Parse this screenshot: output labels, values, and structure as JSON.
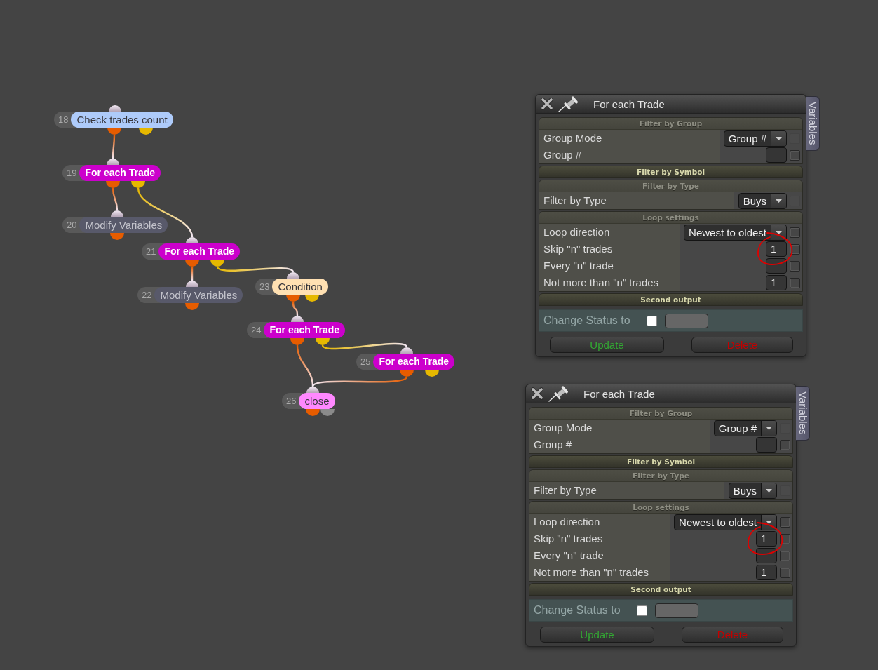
{
  "nodes": [
    {
      "number": "18",
      "label": "Check trades count",
      "kind": "check",
      "color": "#aecbfa",
      "outputs": [
        {
          "color": "#e65c00"
        },
        {
          "color": "#e6b800"
        }
      ]
    },
    {
      "number": "19",
      "label": "For each Trade",
      "kind": "loop",
      "color": "#cc00cc",
      "outputs": [
        {
          "color": "#e65c00"
        },
        {
          "color": "#e6b800"
        }
      ]
    },
    {
      "number": "20",
      "label": "Modify Variables",
      "kind": "action",
      "color": "#58596a",
      "outputs": [
        {
          "color": "#e65c00"
        }
      ]
    },
    {
      "number": "21",
      "label": "For each Trade",
      "kind": "loop",
      "color": "#cc00cc",
      "outputs": [
        {
          "color": "#e65c00"
        },
        {
          "color": "#e6b800"
        }
      ]
    },
    {
      "number": "22",
      "label": "Modify Variables",
      "kind": "action",
      "color": "#58596a",
      "outputs": [
        {
          "color": "#e65c00"
        }
      ]
    },
    {
      "number": "23",
      "label": "Condition",
      "kind": "condition",
      "color": "#ffe0b2",
      "outputs": [
        {
          "color": "#e65c00"
        },
        {
          "color": "#e6b800"
        }
      ]
    },
    {
      "number": "24",
      "label": "For each Trade",
      "kind": "loop",
      "color": "#cc00cc",
      "outputs": [
        {
          "color": "#e65c00"
        },
        {
          "color": "#e6b800"
        }
      ]
    },
    {
      "number": "25",
      "label": "For each Trade",
      "kind": "loop",
      "color": "#cc00cc",
      "outputs": [
        {
          "color": "#e65c00"
        },
        {
          "color": "#e6b800"
        }
      ]
    },
    {
      "number": "26",
      "label": "close",
      "kind": "close",
      "color": "#ff88ff",
      "outputs": [
        {
          "color": "#e65c00"
        },
        {
          "color": "#8a8a8a"
        }
      ]
    }
  ],
  "panels": [
    {
      "title": "For each Trade",
      "side_tab": "Variables",
      "sections": [
        {
          "kind": "group",
          "title": "Filter by Group",
          "rows": [
            {
              "kind": "select",
              "label": "Group Mode",
              "value": "Group #",
              "annotated": false,
              "checkbox": {
                "checked": false,
                "disabled": true
              }
            },
            {
              "kind": "number",
              "label": "Group #",
              "annotated": false,
              "checkbox": {
                "checked": false,
                "disabled": false
              }
            }
          ]
        },
        {
          "kind": "bar",
          "title": "Filter by Symbol"
        },
        {
          "kind": "group",
          "title": "Filter by Type",
          "rows": [
            {
              "kind": "select",
              "label": "Filter by Type",
              "value": "Buys",
              "annotated": false,
              "checkbox": {
                "checked": false,
                "disabled": true
              }
            }
          ]
        },
        {
          "kind": "group",
          "title": "Loop settings",
          "rows": [
            {
              "kind": "select",
              "label": "Loop direction",
              "value": "Newest to oldest",
              "annotated": false,
              "checkbox": {
                "checked": false,
                "disabled": false
              }
            },
            {
              "kind": "number",
              "label": "Skip \"n\" trades",
              "value": "1",
              "annotated": true,
              "checkbox": {
                "checked": false,
                "disabled": false
              }
            },
            {
              "kind": "number",
              "label": "Every \"n\" trade",
              "annotated": false,
              "checkbox": {
                "checked": false,
                "disabled": false
              }
            },
            {
              "kind": "number",
              "label": "Not more than \"n\" trades",
              "value": "1",
              "annotated": false,
              "checkbox": {
                "checked": false,
                "disabled": false
              }
            }
          ]
        },
        {
          "kind": "bar",
          "title": "Second output"
        }
      ],
      "status_row": {
        "label": "Change Status to",
        "checked": false
      },
      "buttons": [
        {
          "label": "Update",
          "kind": "update"
        },
        {
          "label": "Delete",
          "kind": "delete"
        }
      ]
    },
    {
      "title": "For each Trade",
      "side_tab": "Variables",
      "sections": [
        {
          "kind": "group",
          "title": "Filter by Group",
          "rows": [
            {
              "kind": "select",
              "label": "Group Mode",
              "value": "Group #",
              "annotated": false,
              "checkbox": {
                "checked": false,
                "disabled": true
              }
            },
            {
              "kind": "number",
              "label": "Group #",
              "annotated": false,
              "checkbox": {
                "checked": false,
                "disabled": false
              }
            }
          ]
        },
        {
          "kind": "bar",
          "title": "Filter by Symbol"
        },
        {
          "kind": "group",
          "title": "Filter by Type",
          "rows": [
            {
              "kind": "select",
              "label": "Filter by Type",
              "value": "Buys",
              "annotated": false,
              "checkbox": {
                "checked": false,
                "disabled": true
              }
            }
          ]
        },
        {
          "kind": "group",
          "title": "Loop settings",
          "rows": [
            {
              "kind": "select",
              "label": "Loop direction",
              "value": "Newest to oldest",
              "annotated": false,
              "checkbox": {
                "checked": false,
                "disabled": false
              }
            },
            {
              "kind": "number",
              "label": "Skip \"n\" trades",
              "value": "1",
              "annotated": true,
              "checkbox": {
                "checked": false,
                "disabled": false
              }
            },
            {
              "kind": "number",
              "label": "Every \"n\" trade",
              "annotated": false,
              "checkbox": {
                "checked": false,
                "disabled": false
              }
            },
            {
              "kind": "number",
              "label": "Not more than \"n\" trades",
              "value": "1",
              "annotated": false,
              "checkbox": {
                "checked": false,
                "disabled": false
              }
            }
          ]
        },
        {
          "kind": "bar",
          "title": "Second output"
        }
      ],
      "status_row": {
        "label": "Change Status to",
        "checked": false
      },
      "buttons": [
        {
          "label": "Update",
          "kind": "update"
        },
        {
          "label": "Delete",
          "kind": "delete"
        }
      ]
    }
  ]
}
